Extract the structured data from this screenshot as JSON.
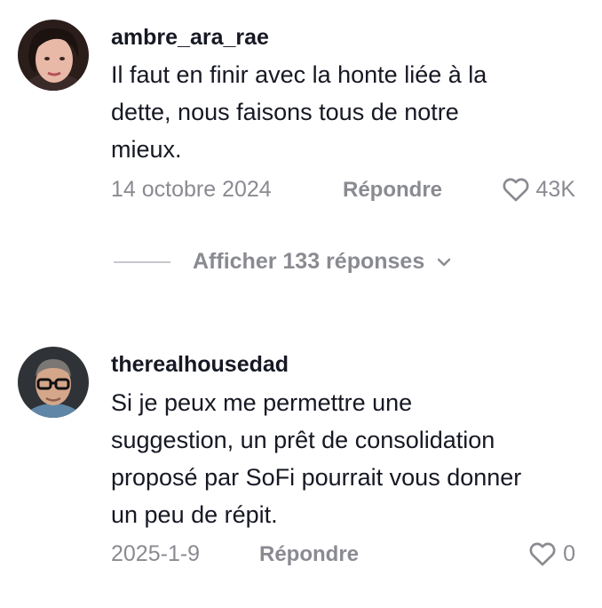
{
  "comments": [
    {
      "username": "ambre_ara_rae",
      "lines": [
        "Il faut en finir avec la honte liée à la",
        "dette, nous faisons tous de notre",
        "mieux."
      ],
      "date": "14 octobre 2024",
      "reply_label": "Répondre",
      "like_count": "43K",
      "avatar_icon": "avatar-woman",
      "replies_toggle": {
        "label": "Afficher 133 réponses",
        "icon": "chevron-down-icon"
      }
    },
    {
      "username": "therealhousedad",
      "lines": [
        "Si je peux me permettre une",
        "suggestion, un prêt de consolidation",
        "proposé par SoFi pourrait vous donner",
        "un peu de répit."
      ],
      "date": "2025-1-9",
      "reply_label": "Répondre",
      "like_count": "0",
      "avatar_icon": "avatar-man-glasses"
    }
  ],
  "colors": {
    "text_primary": "#161823",
    "text_secondary": "#8a8b91",
    "divider": "#c7c8cc"
  }
}
